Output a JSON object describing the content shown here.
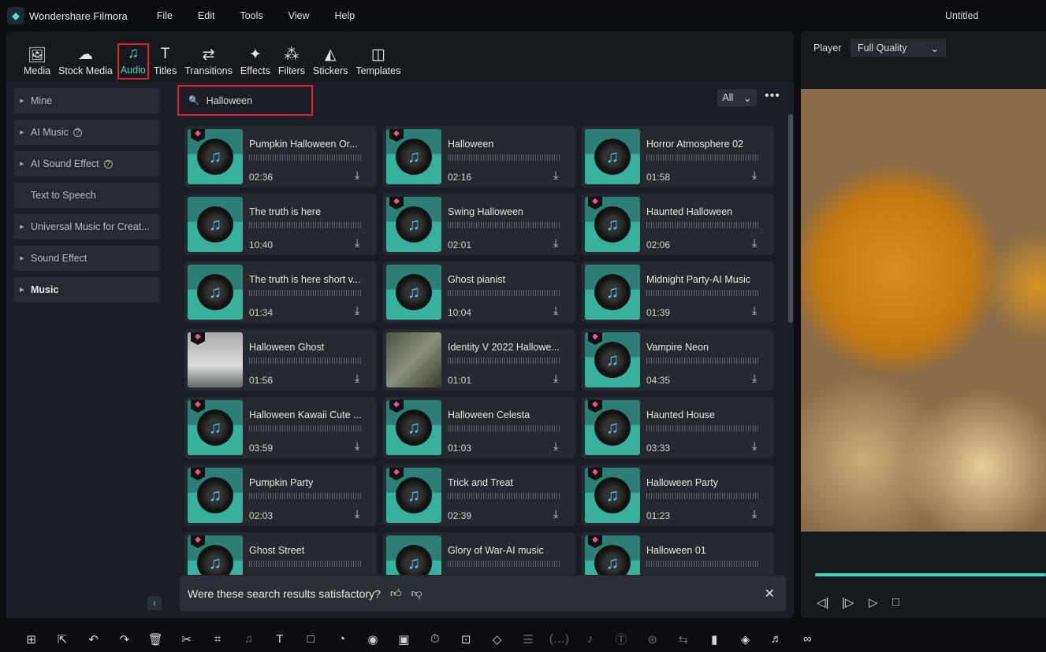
{
  "app": {
    "name": "Wondershare Filmora",
    "doc_title": "Untitled",
    "menu": [
      "File",
      "Edit",
      "Tools",
      "View",
      "Help"
    ]
  },
  "tabs": [
    {
      "label": "Media",
      "icon": "image-icon"
    },
    {
      "label": "Stock Media",
      "icon": "cloud-folder-icon"
    },
    {
      "label": "Audio",
      "icon": "music-note-icon",
      "active": true
    },
    {
      "label": "Titles",
      "icon": "text-icon"
    },
    {
      "label": "Transitions",
      "icon": "transition-icon"
    },
    {
      "label": "Effects",
      "icon": "magic-wand-icon"
    },
    {
      "label": "Filters",
      "icon": "filters-icon"
    },
    {
      "label": "Stickers",
      "icon": "sticker-icon"
    },
    {
      "label": "Templates",
      "icon": "template-icon"
    }
  ],
  "sidebar": [
    {
      "label": "Mine",
      "arrow": true
    },
    {
      "label": "AI Music",
      "arrow": true,
      "help": true
    },
    {
      "label": "AI Sound Effect",
      "arrow": true,
      "help": true
    },
    {
      "label": "Text to Speech",
      "arrow": false
    },
    {
      "label": "Universal Music for Creat...",
      "arrow": true
    },
    {
      "label": "Sound Effect",
      "arrow": true
    },
    {
      "label": "Music",
      "arrow": true,
      "selected": true
    }
  ],
  "search": {
    "value": "Halloween"
  },
  "filter": {
    "value": "All"
  },
  "tracks": [
    {
      "title": "Pumpkin Halloween Or...",
      "duration": "02:36",
      "premium": true
    },
    {
      "title": "Halloween",
      "duration": "02:16",
      "premium": true
    },
    {
      "title": "Horror Atmosphere 02",
      "duration": "01:58",
      "premium": false
    },
    {
      "title": "The truth is here",
      "duration": "10:40",
      "premium": false
    },
    {
      "title": "Swing Halloween",
      "duration": "02:01",
      "premium": true
    },
    {
      "title": "Haunted Halloween",
      "duration": "02:06",
      "premium": true
    },
    {
      "title": "The truth is here short v...",
      "duration": "01:34",
      "premium": false
    },
    {
      "title": "Ghost pianist",
      "duration": "10:04",
      "premium": false
    },
    {
      "title": "Midnight Party-AI Music",
      "duration": "01:39",
      "premium": false
    },
    {
      "title": "Halloween Ghost",
      "duration": "01:56",
      "premium": true,
      "thumb": "img1"
    },
    {
      "title": "Identity V 2022 Hallowe...",
      "duration": "01:01",
      "premium": false,
      "thumb": "img2"
    },
    {
      "title": "Vampire Neon",
      "duration": "04:35",
      "premium": true
    },
    {
      "title": "Halloween Kawaii Cute ...",
      "duration": "03:59",
      "premium": true
    },
    {
      "title": "Halloween Celesta",
      "duration": "01:03",
      "premium": true
    },
    {
      "title": "Haunted House",
      "duration": "03:33",
      "premium": true
    },
    {
      "title": "Pumpkin Party",
      "duration": "02:03",
      "premium": true
    },
    {
      "title": "Trick and Treat",
      "duration": "02:39",
      "premium": true
    },
    {
      "title": "Halloween Party",
      "duration": "01:23",
      "premium": true
    },
    {
      "title": "Ghost Street",
      "duration": "",
      "premium": true
    },
    {
      "title": "Glory of War-AI music",
      "duration": "",
      "premium": false
    },
    {
      "title": "Halloween 01",
      "duration": "",
      "premium": true
    }
  ],
  "feedback": {
    "text": "Were these search results satisfactory?"
  },
  "player": {
    "label": "Player",
    "quality": "Full Quality",
    "progress": 1.0
  },
  "colors": {
    "accent": "#3ed8c3",
    "highlight": "#e0212b",
    "premium": "#ff4f9a"
  },
  "bottom_tools": [
    "layout-icon",
    "select-icon",
    "undo-icon",
    "redo-icon",
    "delete-icon",
    "cut-icon",
    "crop-icon",
    "audio-icon",
    "text-icon",
    "rectangle-icon",
    "speed-icon",
    "color-icon",
    "mask-icon",
    "timer-icon",
    "fit-icon",
    "keyframe-icon",
    "adjust-icon",
    "more-icon",
    "audio-stretch-icon",
    "tts-icon",
    "ai-icon",
    "translate-icon",
    "freeze-icon",
    "ai-clip-icon",
    "ai-music-icon",
    "link-icon"
  ]
}
